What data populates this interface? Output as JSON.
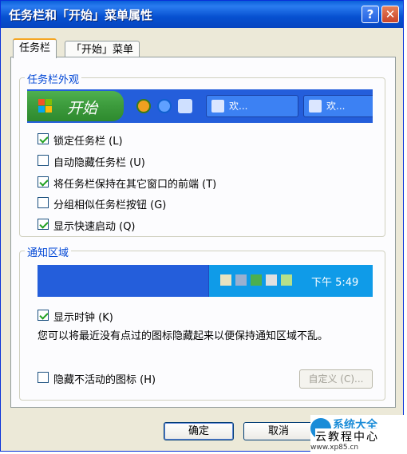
{
  "window": {
    "title": "任务栏和「开始」菜单属性",
    "help_label": "?",
    "close_label": "✕"
  },
  "tabs": [
    {
      "label": "任务栏",
      "active": true
    },
    {
      "label": "「开始」菜单",
      "active": false
    }
  ],
  "taskbar_group": {
    "title": "任务栏外观",
    "preview": {
      "start_label": "开始",
      "buttons": [
        {
          "label": "欢..."
        },
        {
          "label": "欢..."
        }
      ]
    },
    "options": [
      {
        "label": "锁定任务栏 (L)",
        "checked": true
      },
      {
        "label": "自动隐藏任务栏 (U)",
        "checked": false
      },
      {
        "label": "将任务栏保持在其它窗口的前端 (T)",
        "checked": true
      },
      {
        "label": "分组相似任务栏按钮 (G)",
        "checked": false
      },
      {
        "label": "显示快速启动 (Q)",
        "checked": true
      }
    ]
  },
  "tray_group": {
    "title": "通知区域",
    "clock_text": "下午 5:49",
    "show_clock": {
      "label": "显示时钟 (K)",
      "checked": true
    },
    "description": "您可以将最近没有点过的图标隐藏起来以便保持通知区域不乱。",
    "hide_inactive": {
      "label": "隐藏不活动的图标 (H)",
      "checked": false
    },
    "customize_label": "自定义 (C)..."
  },
  "buttons": {
    "ok": "确定",
    "cancel": "取消"
  },
  "watermark": {
    "top": "系统大全",
    "main": "云教程中心",
    "url": "www.xp85.cn"
  },
  "colors": {
    "titlebar": "#0a5fd8",
    "start_button": "#3c9a3c",
    "taskbar": "#245edb",
    "tray": "#0f9be8",
    "group_title": "#0046d5",
    "check": "#21a121"
  }
}
